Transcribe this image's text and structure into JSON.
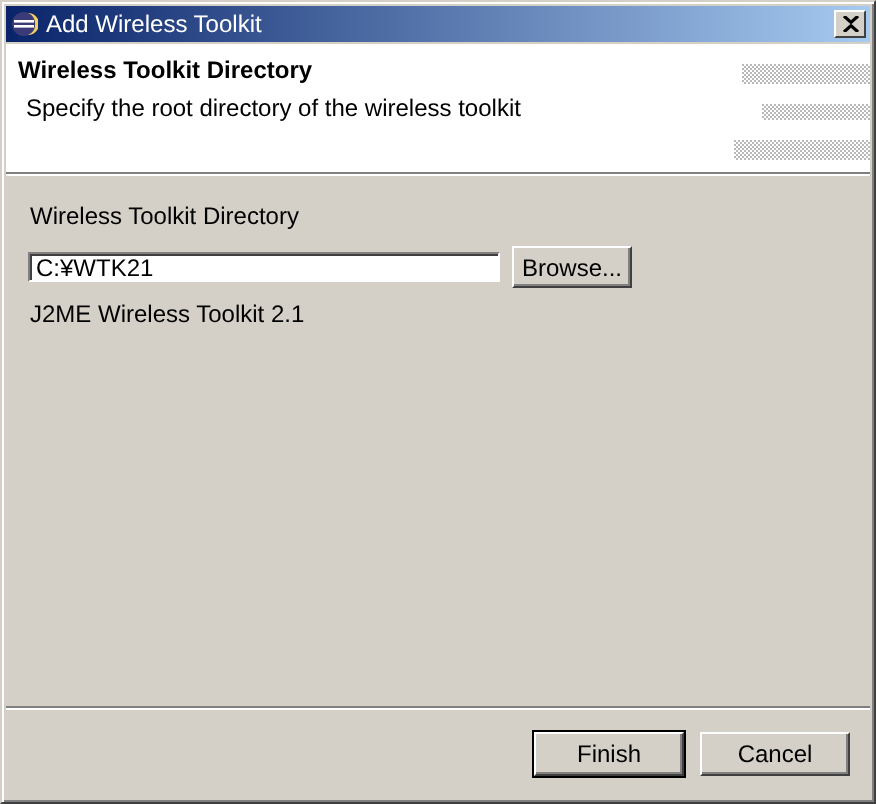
{
  "window": {
    "title": "Add Wireless Toolkit"
  },
  "header": {
    "title": "Wireless Toolkit Directory",
    "description": "Specify the root directory of the wireless toolkit"
  },
  "directory": {
    "label": "Wireless Toolkit Directory",
    "value": "C:¥WTK21",
    "browse": "Browse...",
    "detected": "J2ME Wireless Toolkit 2.1"
  },
  "buttons": [
    {
      "label": "Finish",
      "default": true
    },
    {
      "label": "Cancel",
      "default": false
    }
  ]
}
